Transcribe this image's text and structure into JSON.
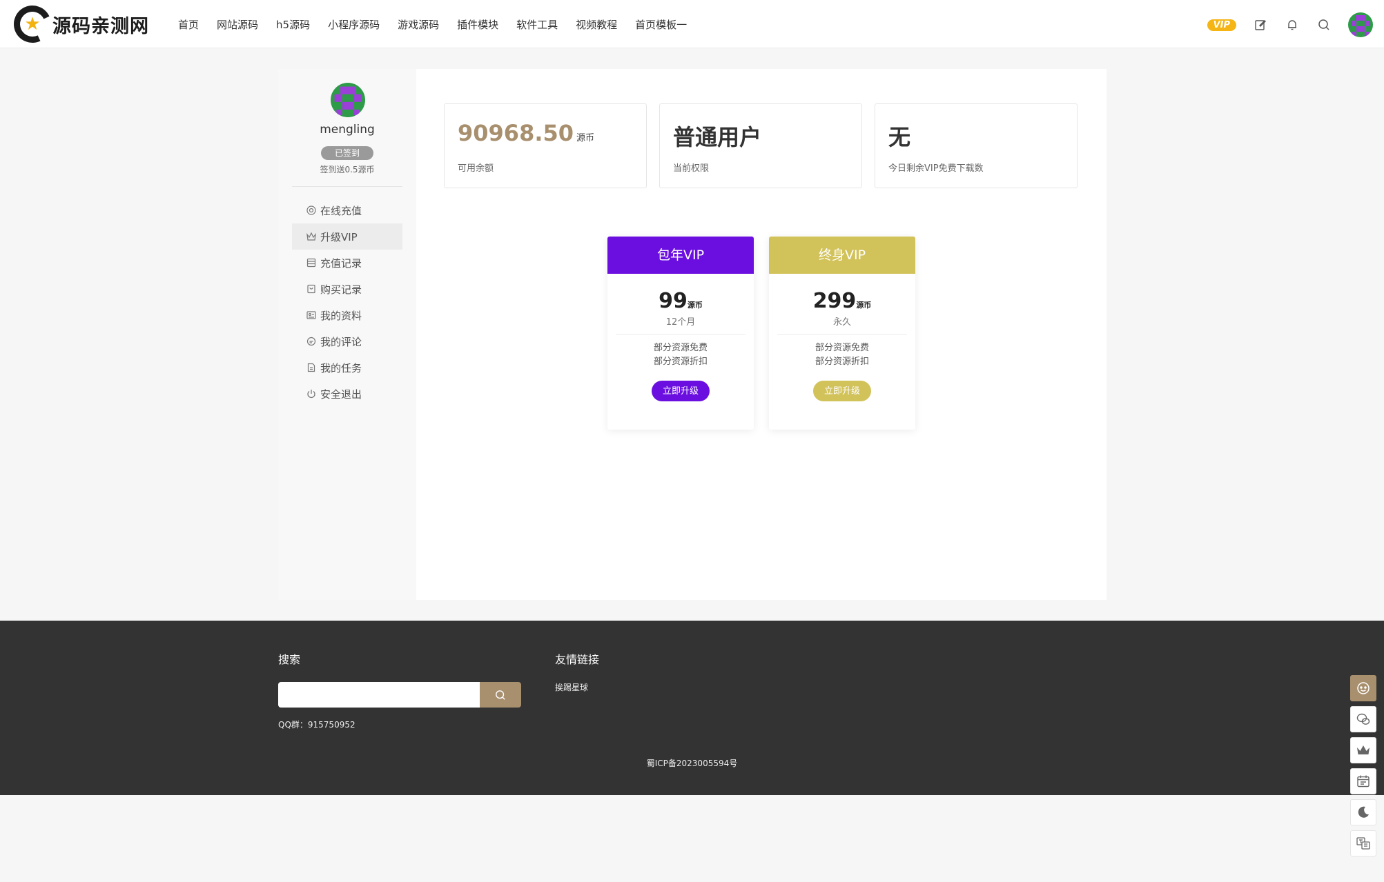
{
  "header": {
    "logo_text": "源码亲测网",
    "nav": [
      "首页",
      "网站源码",
      "h5源码",
      "小程序源码",
      "游戏源码",
      "插件模块",
      "软件工具",
      "视频教程",
      "首页模板一"
    ],
    "vip_label": "VIP",
    "icons": [
      "edit-icon",
      "bell-icon",
      "search-icon",
      "avatar"
    ]
  },
  "sidebar": {
    "username": "mengling",
    "signed_label": "已签到",
    "sign_note": "签到送0.5源币",
    "menu": [
      {
        "label": "在线充值",
        "icon": "coin-icon"
      },
      {
        "label": "升级VIP",
        "icon": "crown-icon"
      },
      {
        "label": "充值记录",
        "icon": "record-icon"
      },
      {
        "label": "购买记录",
        "icon": "bag-icon"
      },
      {
        "label": "我的资料",
        "icon": "profile-card-icon"
      },
      {
        "label": "我的评论",
        "icon": "comment-icon"
      },
      {
        "label": "我的任务",
        "icon": "task-icon"
      },
      {
        "label": "安全退出",
        "icon": "power-icon"
      }
    ],
    "active_index": 1
  },
  "stats": [
    {
      "value": "90968.50",
      "unit": "源币",
      "label": "可用余额"
    },
    {
      "value": "普通用户",
      "unit": "",
      "label": "当前权限"
    },
    {
      "value": "无",
      "unit": "",
      "label": "今日剩余VIP免费下载数"
    }
  ],
  "plans": [
    {
      "name": "包年VIP",
      "price": "99",
      "unit": "源币",
      "period": "12个月",
      "features": [
        "部分资源免费",
        "部分资源折扣"
      ],
      "button": "立即升级",
      "color": "#6b0fe0"
    },
    {
      "name": "终身VIP",
      "price": "299",
      "unit": "源币",
      "period": "永久",
      "features": [
        "部分资源免费",
        "部分资源折扣"
      ],
      "button": "立即升级",
      "color": "#d2c25a"
    }
  ],
  "footer": {
    "search_title": "搜索",
    "qq_group": "QQ群：915750952",
    "links_title": "友情链接",
    "link_1": "挨踢星球",
    "icp": "蜀ICP备2023005594号"
  },
  "colors": {
    "accent": "#a88f6e",
    "vip_gold": "#f4b515",
    "footer_bg": "#333333"
  },
  "float_tools": [
    "customer-service-icon",
    "wechat-icon",
    "crown-icon",
    "calendar-icon",
    "moon-icon",
    "translate-icon"
  ]
}
